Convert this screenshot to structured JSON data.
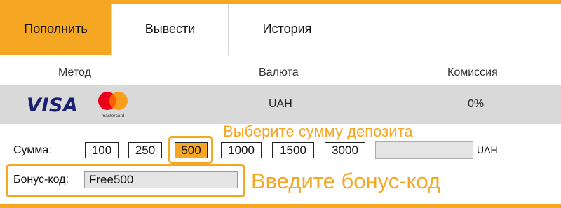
{
  "tabs": [
    {
      "label": "Пополнить",
      "active": true
    },
    {
      "label": "Вывести",
      "active": false
    },
    {
      "label": "История",
      "active": false
    }
  ],
  "table": {
    "headers": {
      "method": "Метод",
      "currency": "Валюта",
      "commission": "Комиссия"
    },
    "row": {
      "payment_methods": [
        {
          "logo": "VISA"
        },
        {
          "logo": "mastercard"
        }
      ],
      "currency": "UAH",
      "commission": "0%"
    }
  },
  "amount": {
    "label": "Сумма:",
    "options": [
      "100",
      "250",
      "500",
      "1000",
      "1500",
      "3000"
    ],
    "selected": "500",
    "custom_value": "",
    "currency": "UAH"
  },
  "bonus": {
    "label": "Бонус-код:",
    "value": "Free500"
  },
  "hints": {
    "amount": "Выберите сумму депозита",
    "bonus": "Введите бонус-код"
  },
  "colors": {
    "accent": "#f5a623",
    "row_background": "#d9d9d9",
    "input_background": "#e4e4e4"
  }
}
